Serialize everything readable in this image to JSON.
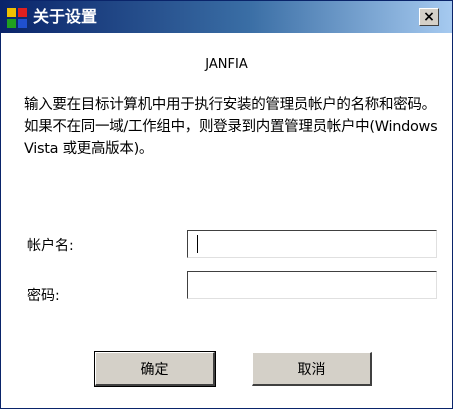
{
  "window": {
    "title": "关于设置",
    "close_label": "×",
    "icon": "app-icon"
  },
  "dialog": {
    "subtitle": "JANFIA",
    "description": "输入要在目标计算机中用于执行安装的管理员帐户的名称和密码。如果不在同一域/工作组中，则登录到内置管理员帐户中(Windows Vista 或更高版本)。"
  },
  "form": {
    "username_label": "帐户名:",
    "username_value": "",
    "password_label": "密码:",
    "password_value": ""
  },
  "buttons": {
    "ok_label": "确定",
    "cancel_label": "取消"
  },
  "colors": {
    "titlebar_start": "#0a246a",
    "titlebar_end": "#a6caf0",
    "button_face": "#d4d0c8"
  }
}
